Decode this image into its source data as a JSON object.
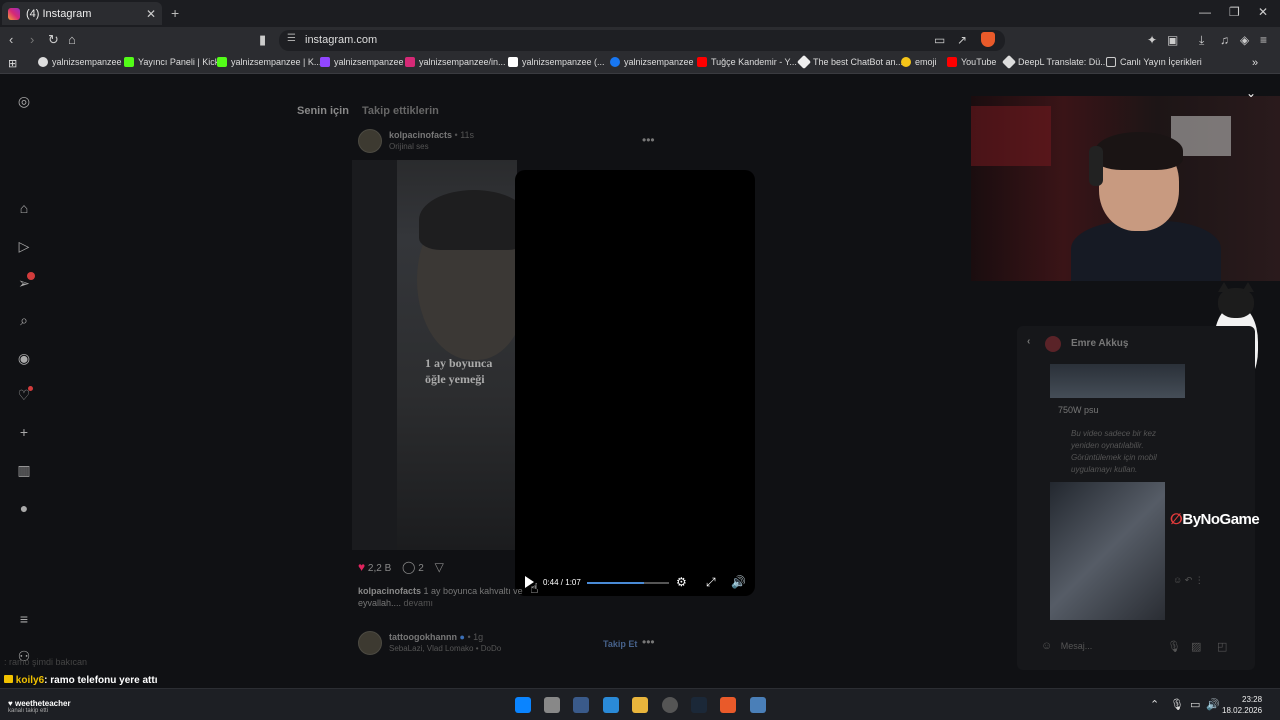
{
  "browser": {
    "tab_title": "(4) Instagram",
    "tab_close": "✕",
    "new_tab": "+",
    "url": "instagram.com",
    "window_controls": [
      "—",
      "❐",
      "✕"
    ]
  },
  "bookmarks": [
    {
      "label": "yalnizsempanzee",
      "color": "#dddddd"
    },
    {
      "label": "Yayıncı Paneli | Kick",
      "color": "#53fc18"
    },
    {
      "label": "yalnizsempanzee | K...",
      "color": "#53fc18"
    },
    {
      "label": "yalnizsempanzee",
      "color": "#9146ff"
    },
    {
      "label": "yalnizsempanzee/in...",
      "color": "#d62976"
    },
    {
      "label": "yalnizsempanzee (...",
      "color": "#ffffff"
    },
    {
      "label": "yalnizsempanzee",
      "color": "#1877f2"
    },
    {
      "label": "Tuğçe Kandemir - Y...",
      "color": "#ff0000"
    },
    {
      "label": "The best ChatBot an...",
      "color": "#eeeeee"
    },
    {
      "label": "emoji",
      "color": "#f5c518"
    },
    {
      "label": "YouTube",
      "color": "#ff0000"
    },
    {
      "label": "DeepL Translate: Dü...",
      "color": "#0f2b46"
    },
    {
      "label": "Canlı Yayın İçerikleri",
      "color": "#cccccc"
    }
  ],
  "feed": {
    "tabs": [
      "Senin için",
      "Takip ettiklerin"
    ],
    "post1": {
      "user": "kolpacinofacts",
      "time": "• 11s",
      "audio": "Orijinal ses",
      "caption_line1": "1 ay boyunca",
      "caption_line2": "öğle yemeği",
      "likes": "2,2 B",
      "comments": "2",
      "text_user": "kolpacinofacts",
      "text": "1 ay boyunca kahvaltı ve",
      "text2": "eyvallah....",
      "more": "devamı"
    },
    "video": {
      "time": "0:44 / 1:07",
      "progress": 0.7
    },
    "post2": {
      "user": "tattoogokhannn",
      "time": "• 1g",
      "audio": "SebaLazi, Vlad Lomako • DoDo",
      "follow": "Takip Et"
    }
  },
  "dm": {
    "name": "Emre Akkuş",
    "psu": "750W psu",
    "note": "Bu video sadece bir kez yeniden oynatılabilir. Görüntülemek için mobil uygulamayı kullan.",
    "placeholder": "Mesaj..."
  },
  "overlay": {
    "sponsor": "ByNoGame",
    "chat1": ": ramo şimdi bakıcan",
    "chat2_user": "koily6",
    "chat2_text": ": ramo telefonu yere attı"
  },
  "taskbar": {
    "notif_title": "weetheteacher",
    "notif_sub": "kanalı takip etti",
    "time": "23:28",
    "date": "18.02.2026"
  }
}
